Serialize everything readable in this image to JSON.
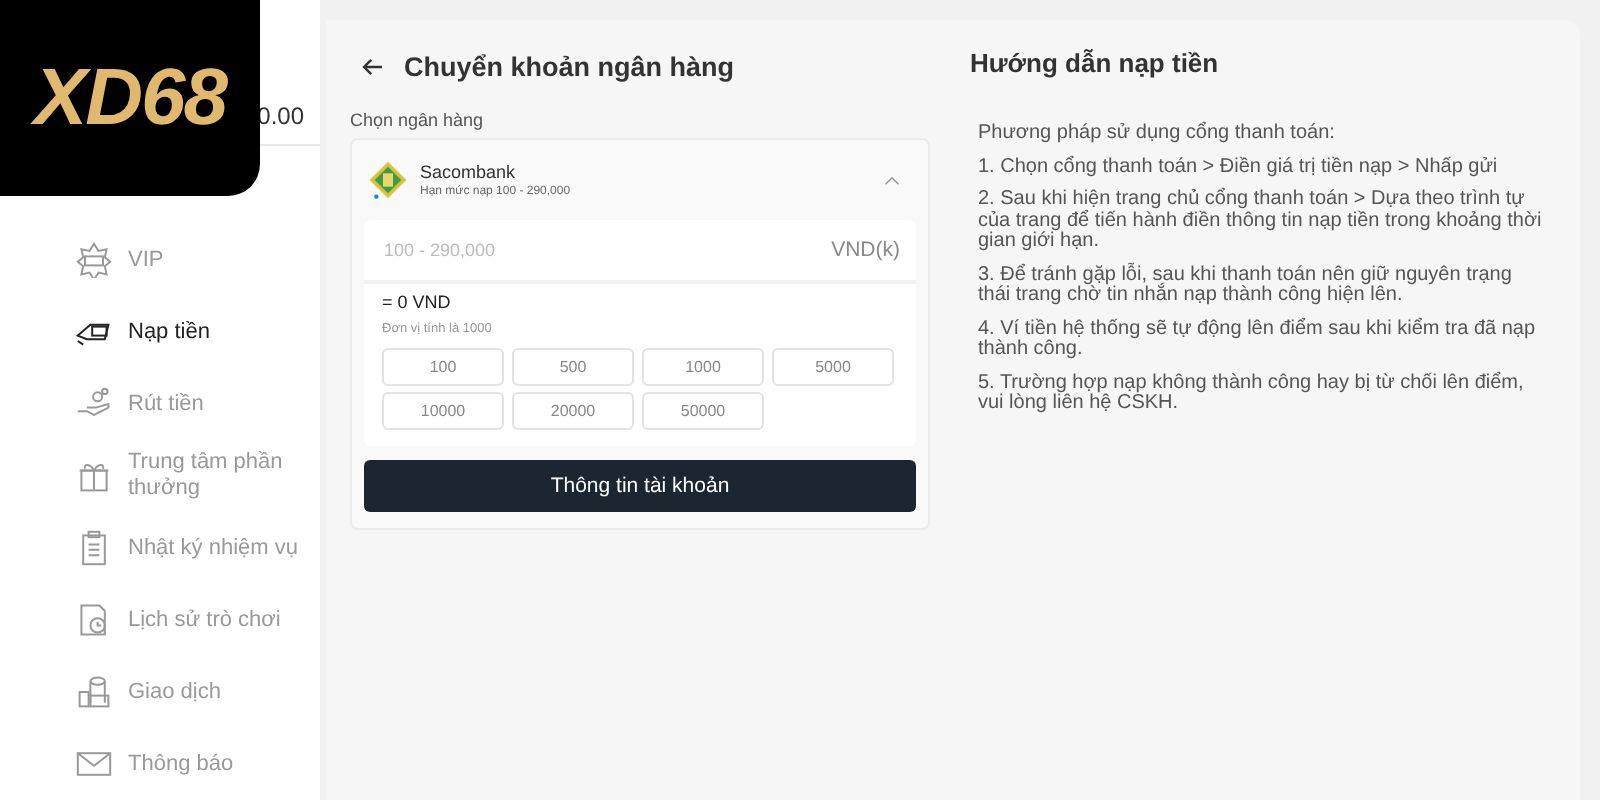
{
  "logo": {
    "text": "XD68"
  },
  "balance": "0.00",
  "sidebar": {
    "items": [
      {
        "label": "VIP",
        "kind": "vip",
        "selected": false
      },
      {
        "label": "Nạp tiền",
        "kind": "deposit",
        "selected": true
      },
      {
        "label": "Rút tiền",
        "kind": "withdraw",
        "selected": false
      },
      {
        "label": "Trung tâm phần thưởng",
        "kind": "gift",
        "selected": false
      },
      {
        "label": "Nhật ký nhiệm vụ",
        "kind": "tasks",
        "selected": false
      },
      {
        "label": "Lịch sử trò chơi",
        "kind": "history",
        "selected": false
      },
      {
        "label": "Giao dịch",
        "kind": "transactions",
        "selected": false
      },
      {
        "label": "Thông báo",
        "kind": "mail",
        "selected": false
      }
    ]
  },
  "deposit": {
    "title": "Chuyển khoản ngân hàng",
    "bank_label": "Chọn ngân hàng",
    "bank": {
      "name": "Sacombank",
      "limit": "Hạn mức nạp 100 - 290,000",
      "expanded": true
    },
    "amount": {
      "placeholder": "100 - 290,000",
      "unit": "VND(k)"
    },
    "converted": "= 0 VND",
    "unit_note": "Đơn vị tính là 1000",
    "presets": [
      "100",
      "500",
      "1000",
      "5000",
      "10000",
      "20000",
      "50000"
    ],
    "submit": "Thông tin tài khoản"
  },
  "guide": {
    "title": "Hướng dẫn nạp tiền",
    "paragraphs": [
      "Phương pháp sử dụng cổng thanh toán:",
      "1. Chọn cổng thanh toán > Điền giá trị tiền nạp > Nhấp gửi",
      "2. Sau khi hiện trang chủ cổng thanh toán > Dựa theo trình tự của trang để tiến hành điền thông tin nạp tiền trong khoảng thời gian giới hạn.",
      "3. Để tránh gặp lỗi, sau khi thanh toán nên giữ nguyên trạng thái trang chờ tin nhắn nạp thành công hiện lên.",
      "4. Ví tiền hệ thống sẽ tự động lên điểm sau khi kiểm tra đã nạp thành công.",
      "5. Trường hợp nạp không thành công hay bị từ chối lên điểm, vui lòng liên hệ CSKH."
    ]
  }
}
